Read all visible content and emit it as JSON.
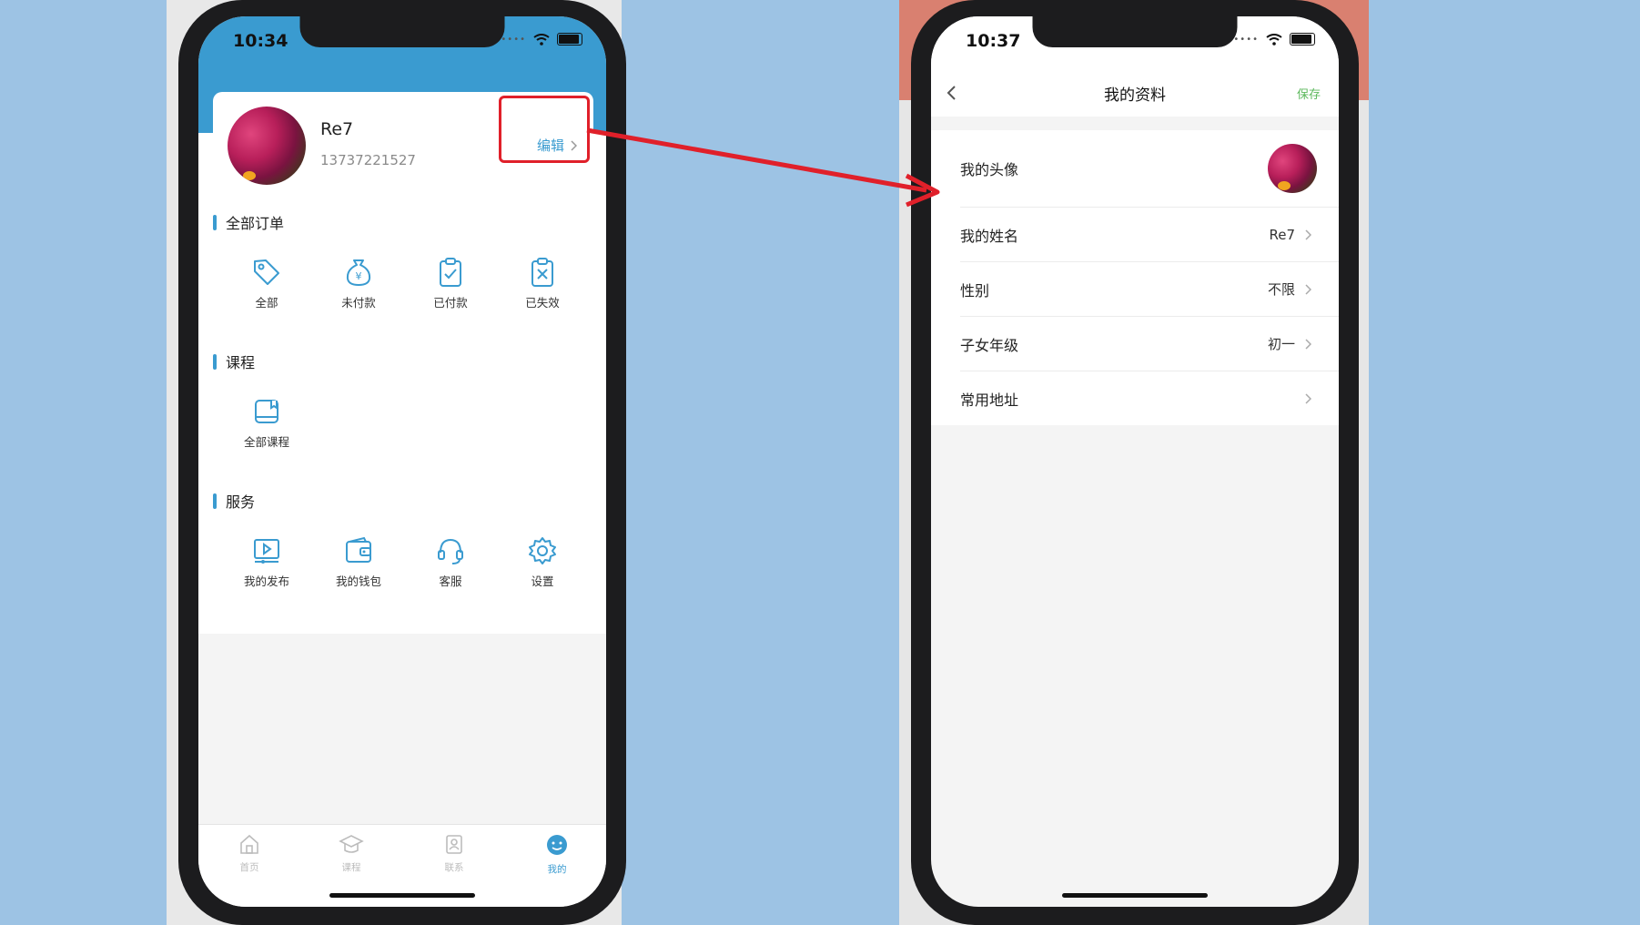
{
  "left_screen": {
    "status_time": "10:34",
    "profile": {
      "name": "Re7",
      "phone": "13737221527",
      "edit_label": "编辑"
    },
    "sections": [
      {
        "title": "全部订单",
        "items": [
          {
            "label": "全部",
            "icon": "tag-icon"
          },
          {
            "label": "未付款",
            "icon": "money-bag-icon"
          },
          {
            "label": "已付款",
            "icon": "clipboard-check-icon"
          },
          {
            "label": "已失效",
            "icon": "clipboard-x-icon"
          }
        ]
      },
      {
        "title": "课程",
        "items": [
          {
            "label": "全部课程",
            "icon": "book-icon"
          }
        ]
      },
      {
        "title": "服务",
        "items": [
          {
            "label": "我的发布",
            "icon": "video-icon"
          },
          {
            "label": "我的钱包",
            "icon": "wallet-icon"
          },
          {
            "label": "客服",
            "icon": "headset-icon"
          },
          {
            "label": "设置",
            "icon": "gear-icon"
          }
        ]
      }
    ],
    "tabbar": [
      {
        "label": "首页",
        "icon": "home-icon"
      },
      {
        "label": "课程",
        "icon": "graduation-cap-icon"
      },
      {
        "label": "联系",
        "icon": "contact-icon"
      },
      {
        "label": "我的",
        "icon": "smiley-icon",
        "active": true
      }
    ]
  },
  "right_screen": {
    "status_time": "10:37",
    "nav": {
      "title": "我的资料",
      "save_label": "保存"
    },
    "rows": [
      {
        "label": "我的头像",
        "value": "",
        "type": "avatar"
      },
      {
        "label": "我的姓名",
        "value": "Re7"
      },
      {
        "label": "性别",
        "value": "不限"
      },
      {
        "label": "子女年级",
        "value": "初一"
      },
      {
        "label": "常用地址",
        "value": ""
      }
    ]
  },
  "colors": {
    "accent": "#3a9bd0",
    "save": "#5cb85c",
    "highlight": "#e0202a",
    "background": "#9dc3e4"
  }
}
